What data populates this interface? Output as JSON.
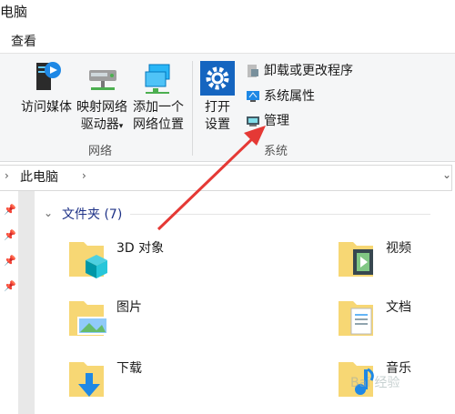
{
  "window": {
    "title": "电脑"
  },
  "ribbon_tab": {
    "label": "查看"
  },
  "ribbon": {
    "network_group": {
      "label": "网络",
      "access_media": [
        "访问媒体"
      ],
      "map_drive": [
        "映射网络",
        "驱动器"
      ],
      "add_location": [
        "添加一个",
        "网络位置"
      ]
    },
    "system_group": {
      "label": "系统",
      "open_settings": [
        "打开",
        "设置"
      ],
      "uninstall": "卸载或更改程序",
      "properties": "系统属性",
      "manage": "管理"
    }
  },
  "address": {
    "path": "此电脑"
  },
  "content": {
    "section_title": "文件夹 (7)",
    "folders": [
      {
        "name": "3D 对象",
        "icon": "3d-objects-folder-icon"
      },
      {
        "name": "视频",
        "icon": "videos-folder-icon"
      },
      {
        "name": "图片",
        "icon": "pictures-folder-icon"
      },
      {
        "name": "文档",
        "icon": "documents-folder-icon"
      },
      {
        "name": "下载",
        "icon": "downloads-folder-icon"
      },
      {
        "name": "音乐",
        "icon": "music-folder-icon"
      }
    ]
  },
  "colors": {
    "accent": "#1e3287",
    "arrow": "#e53935",
    "folder": "#f7d774"
  },
  "watermark": "Bai 经验"
}
